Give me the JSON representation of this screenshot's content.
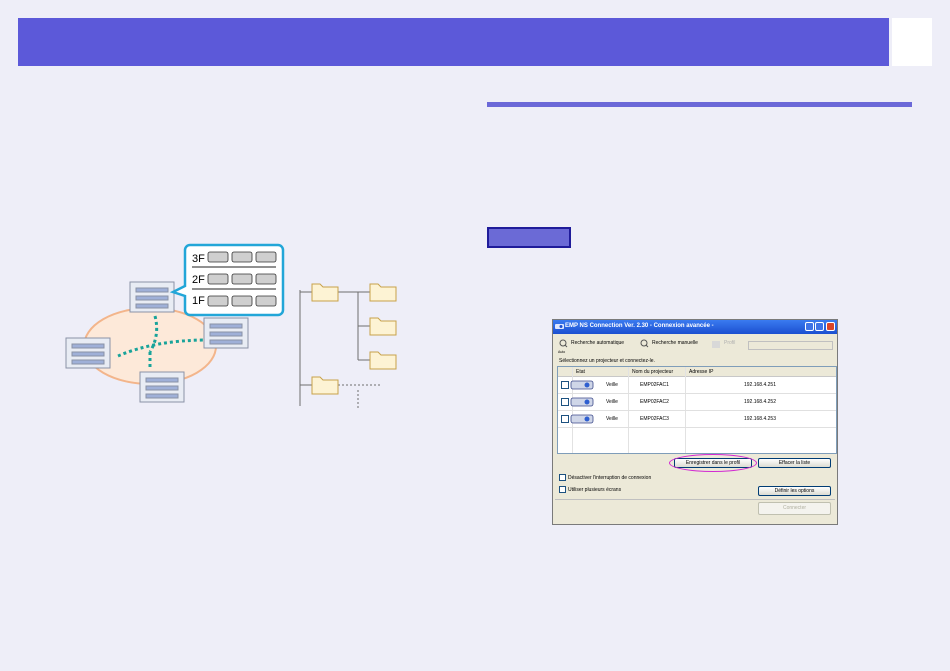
{
  "window": {
    "title": "EMP NS Connection Ver. 2.30 - Connexion avancée -"
  },
  "toolbar": {
    "auto_search": "Recherche automatique",
    "auto_icon_label": "Auto",
    "manual_search": "Recherche manuelle",
    "profile": "Profil"
  },
  "instruction": "Sélectionnez un projecteur et connectez-le.",
  "table": {
    "headers": [
      "Etat",
      "Nom du projecteur",
      "Adresse IP"
    ],
    "rows": [
      {
        "state": "Veille",
        "name": "EMP02FAC1",
        "ip": "192.168.4.251"
      },
      {
        "state": "Veille",
        "name": "EMP02FAC2",
        "ip": "192.168.4.252"
      },
      {
        "state": "Veille",
        "name": "EMP02FAC3",
        "ip": "192.168.4.253"
      }
    ]
  },
  "buttons": {
    "save_profile": "Enregistrer dans le profil",
    "clear_list": "Effacer la liste",
    "set_options": "Définir les options",
    "connect": "Connecter"
  },
  "options": {
    "disable_interrupt": "Désactiver l'interruption de connexion",
    "multi_screen": "Utiliser plusieurs écrans"
  },
  "illustration": {
    "floors": [
      "3F",
      "2F",
      "1F"
    ]
  },
  "colors": {
    "header": "#5c59d9",
    "accent": "#6b68d8",
    "highlight": "#d22ad2"
  }
}
